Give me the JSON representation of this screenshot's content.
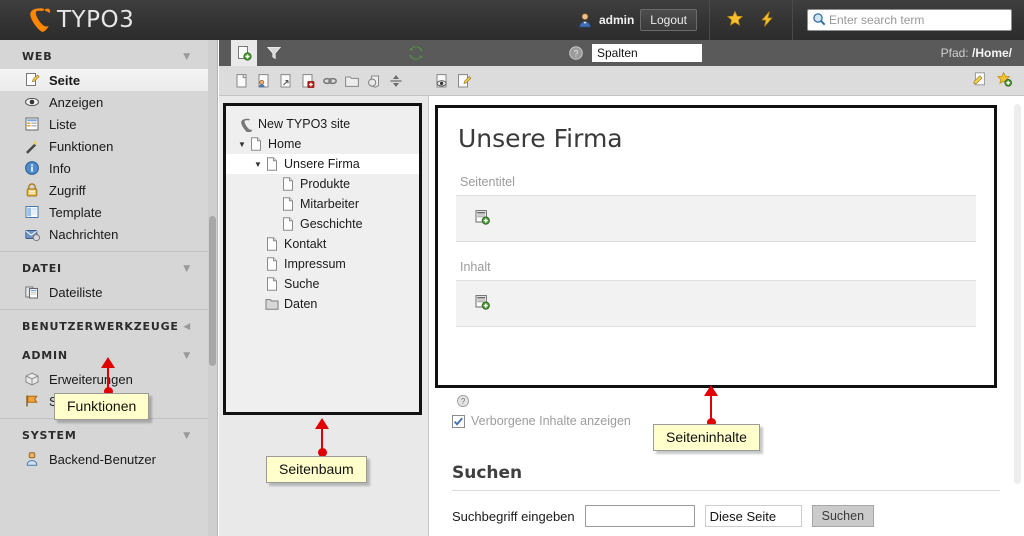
{
  "topbar": {
    "logo_text": "TYPO3",
    "logo_icon": "typo3-logo-icon",
    "user_name": "admin",
    "user_avatar_icon": "user-avatar-icon",
    "logout_label": "Logout",
    "bookmark_icon": "star-icon",
    "clear_cache_icon": "lightning-bolt-icon",
    "search_icon": "search-icon",
    "search_placeholder": "Enter search term",
    "search_value": ""
  },
  "sidebar": {
    "sections": [
      {
        "title": "WEB",
        "caret": "▼",
        "items": [
          {
            "label": "Seite",
            "icon": "page-edit-icon",
            "selected": true
          },
          {
            "label": "Anzeigen",
            "icon": "eye-icon",
            "selected": false
          },
          {
            "label": "Liste",
            "icon": "list-icon",
            "selected": false
          },
          {
            "label": "Funktionen",
            "icon": "magic-wand-icon",
            "selected": false
          },
          {
            "label": "Info",
            "icon": "info-circle-icon",
            "selected": false
          },
          {
            "label": "Zugriff",
            "icon": "lock-icon",
            "selected": false
          },
          {
            "label": "Template",
            "icon": "template-icon",
            "selected": false
          },
          {
            "label": "Nachrichten",
            "icon": "messages-icon",
            "selected": false
          }
        ]
      },
      {
        "title": "DATEI",
        "caret": "▼",
        "items": [
          {
            "label": "Dateiliste",
            "icon": "filelist-icon",
            "selected": false
          }
        ]
      },
      {
        "title": "BENUTZERWERKZEUGE",
        "caret": "◀",
        "items": []
      },
      {
        "title": "ADMIN",
        "caret": "▼",
        "items": [
          {
            "label": "Erweiterungen",
            "icon": "extension-icon",
            "selected": false
          },
          {
            "label": "Sprachen",
            "icon": "flag-icon",
            "selected": false
          }
        ]
      },
      {
        "title": "SYSTEM",
        "caret": "▼",
        "items": [
          {
            "label": "Backend-Benutzer",
            "icon": "backend-user-icon",
            "selected": false
          }
        ]
      }
    ]
  },
  "modulebar": {
    "new_page_icon": "new-page-icon",
    "filter_icon": "filter-funnel-icon",
    "refresh_icon": "refresh-icon",
    "help_icon": "help-circle-icon",
    "view_mode_value": "Spalten",
    "path_label": "Pfad:",
    "path_value": "/Home/"
  },
  "doctoolbar": {
    "icons": [
      "new-page-icon",
      "page-user-icon",
      "page-shortcut-icon",
      "page-delete-icon",
      "link-icon",
      "folder-icon",
      "recycler-icon",
      "sort-icon",
      "preview-eye-icon",
      "edit-pencil-icon"
    ],
    "right_icons": [
      "open-in-frontend-icon",
      "bookmark-add-icon"
    ]
  },
  "pagetree": {
    "nodes": [
      {
        "label": "New TYPO3 site",
        "icon": "typo3-root-icon",
        "depth": 0,
        "toggle": "",
        "active": false
      },
      {
        "label": "Home",
        "icon": "page-icon",
        "depth": 1,
        "toggle": "▼",
        "active": false
      },
      {
        "label": "Unsere Firma",
        "icon": "page-icon",
        "depth": 2,
        "toggle": "▼",
        "active": true
      },
      {
        "label": "Produkte",
        "icon": "page-icon",
        "depth": 3,
        "toggle": "",
        "active": false
      },
      {
        "label": "Mitarbeiter",
        "icon": "page-icon",
        "depth": 3,
        "toggle": "",
        "active": false
      },
      {
        "label": "Geschichte",
        "icon": "page-icon",
        "depth": 3,
        "toggle": "",
        "active": false
      },
      {
        "label": "Kontakt",
        "icon": "page-icon",
        "depth": 2,
        "toggle": "",
        "active": false
      },
      {
        "label": "Impressum",
        "icon": "page-icon",
        "depth": 2,
        "toggle": "",
        "active": false
      },
      {
        "label": "Suche",
        "icon": "page-icon",
        "depth": 2,
        "toggle": "",
        "active": false
      },
      {
        "label": "Daten",
        "icon": "folder-icon",
        "depth": 2,
        "toggle": "",
        "active": false
      }
    ]
  },
  "content": {
    "page_title": "Unsere Firma",
    "columns": [
      {
        "label": "Seitentitel",
        "new_content_icon": "new-content-element-icon"
      },
      {
        "label": "Inhalt",
        "new_content_icon": "new-content-element-icon"
      }
    ],
    "hidden_hint_icon": "help-circle-icon",
    "show_hidden_label": "Verborgene Inhalte anzeigen",
    "show_hidden_checked": true,
    "search": {
      "heading": "Suchen",
      "label": "Suchbegriff eingeben",
      "input_value": "",
      "scope_value": "Diese Seite",
      "button_label": "Suchen"
    }
  },
  "annotations": [
    {
      "label": "Seitenbaum",
      "target": "page-tree"
    },
    {
      "label": "Funktionen",
      "target": "module-menu"
    },
    {
      "label": "Seiteninhalte",
      "target": "page-content"
    }
  ],
  "colors": {
    "accent_orange": "#ff8700",
    "topbar_dark": "#343434",
    "sidebar_grey": "#d6d6d6",
    "annotation_red": "#e00000",
    "callout_yellow": "#ffffcc"
  }
}
